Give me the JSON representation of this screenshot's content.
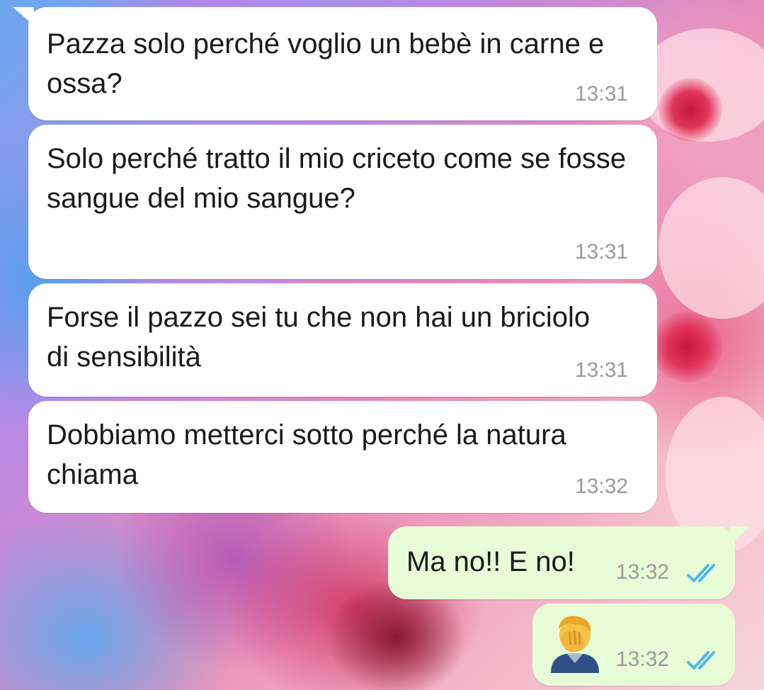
{
  "messages": [
    {
      "direction": "incoming",
      "text": "Pazza solo perché voglio un bebè in carne e ossa?",
      "time": "13:31"
    },
    {
      "direction": "incoming",
      "text": "Solo perché tratto il mio criceto come se fosse sangue del mio sangue?",
      "time": "13:31"
    },
    {
      "direction": "incoming",
      "text": "Forse il pazzo sei tu che non hai un briciolo di sensibilità",
      "time": "13:31"
    },
    {
      "direction": "incoming",
      "text": "Dobbiamo metterci sotto perché la natura chiama",
      "time": "13:32"
    },
    {
      "direction": "outgoing",
      "text": "Ma no!! E no!",
      "time": "13:32",
      "status": "read-double-check-icon"
    },
    {
      "direction": "outgoing",
      "emoji": "man-facepalming-emoji",
      "time": "13:32",
      "status": "read-double-check-icon"
    }
  ],
  "colors": {
    "incoming_bubble": "#ffffff",
    "outgoing_bubble": "#e8fcd7",
    "timestamp": "#9a9a9a",
    "read_ticks": "#4fb6ec"
  },
  "wallpaper": "pink-flower-watercolor"
}
